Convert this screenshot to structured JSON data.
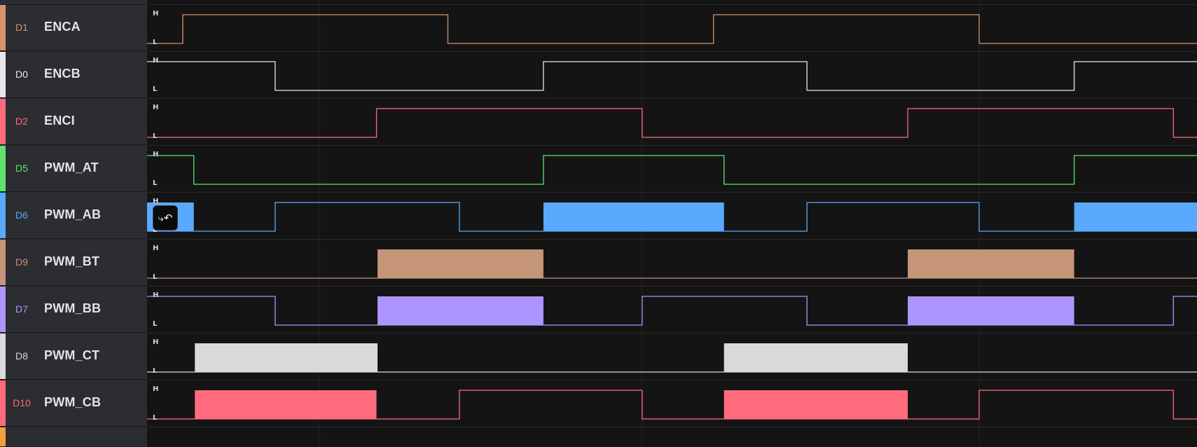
{
  "levels": {
    "high": "H",
    "low": "L"
  },
  "trigger": {
    "icon": "trigger-edge-icon",
    "glyph": "⤷↶"
  },
  "channels": [
    {
      "tag": "D1",
      "name": "ENCA",
      "color": "#d9916c",
      "fill": false,
      "trace": "0L 0.034H 0.2865L 0.5395H 0.7925L 1.0"
    },
    {
      "tag": "D0",
      "name": "ENCB",
      "color": "#e8e8e8",
      "fill": false,
      "trace": "0H 0.122L 0.3775H 0.6285L 0.883H 1.0"
    },
    {
      "tag": "D2",
      "name": "ENCI",
      "color": "#ff6b7a",
      "fill": false,
      "trace": "0L 0.2185H 0.4715L 0.7245H 0.9775L 1.0"
    },
    {
      "tag": "D5",
      "name": "PWM_AT",
      "color": "#5ee36e",
      "fill": true,
      "trace": "0H 0.0445L 0.3775H 0.5495L 0.883H 1.0"
    },
    {
      "tag": "D6",
      "name": "PWM_AB",
      "color": "#59a9ff",
      "fill": true,
      "trace": "0F 0.0445L 0.122H 0.2975L 0.3775F 0.5495L 0.6285H 0.7925L 0.883F 1.0"
    },
    {
      "tag": "D9",
      "name": "PWM_BT",
      "color": "#c69479",
      "fill": true,
      "trace": "0L 0.2195F 0.3775L 0.7245F 0.883L 1.0"
    },
    {
      "tag": "D7",
      "name": "PWM_BB",
      "color": "#ad95ff",
      "fill": true,
      "trace": "0H 0.122L 0.2195F 0.3775L 0.4715H 0.6285L 0.7245F 0.883L 0.9775H 1.0"
    },
    {
      "tag": "D8",
      "name": "PWM_CT",
      "color": "#d9d9d9",
      "fill": true,
      "trace": "0L 0.0455F 0.2195L 0.5495F 0.7245L 1.0"
    },
    {
      "tag": "D10",
      "name": "PWM_CB",
      "color": "#ff6b7c",
      "fill": true,
      "trace": "0L 0.0455F 0.2185L 0.2975H 0.4715L 0.5495F 0.7245L 0.7925H 0.9775L 1.0"
    }
  ],
  "extra_channel_color": "#f2a23a",
  "colors": {
    "plot_bg": "#141414",
    "grid": "#222222",
    "row_border": "#2a2a2a",
    "sidebar_bg": "#2b2d31"
  }
}
